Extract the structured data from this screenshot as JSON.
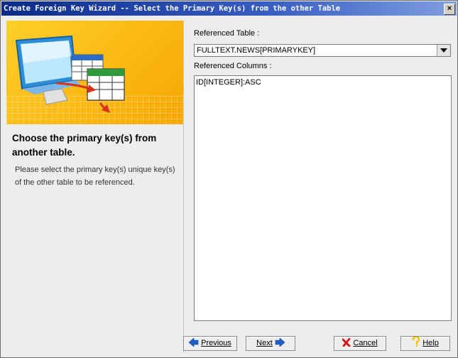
{
  "window": {
    "title": "Create Foreign Key Wizard -- Select the Primary Key(s) from the other Table",
    "close_label": "×"
  },
  "left": {
    "heading": "Choose the primary key(s) from another table.",
    "description": "Please select the primary key(s) unique key(s) of the other table to be referenced."
  },
  "form": {
    "referenced_table_label": "Referenced Table :",
    "referenced_table_value": "FULLTEXT.NEWS[PRIMARYKEY]",
    "referenced_columns_label": "Referenced Columns :",
    "columns": [
      "ID[INTEGER]:ASC"
    ]
  },
  "buttons": {
    "previous_label": "Previous",
    "next_label": "Next",
    "cancel_label": "Cancel",
    "help_label": "Help"
  },
  "colors": {
    "titlebar": "#0b2a8a",
    "banner": "#f7a600",
    "arrow_blue": "#1f5fcc",
    "cancel_red": "#cc1a1a",
    "help_yellow": "#f2c200"
  }
}
